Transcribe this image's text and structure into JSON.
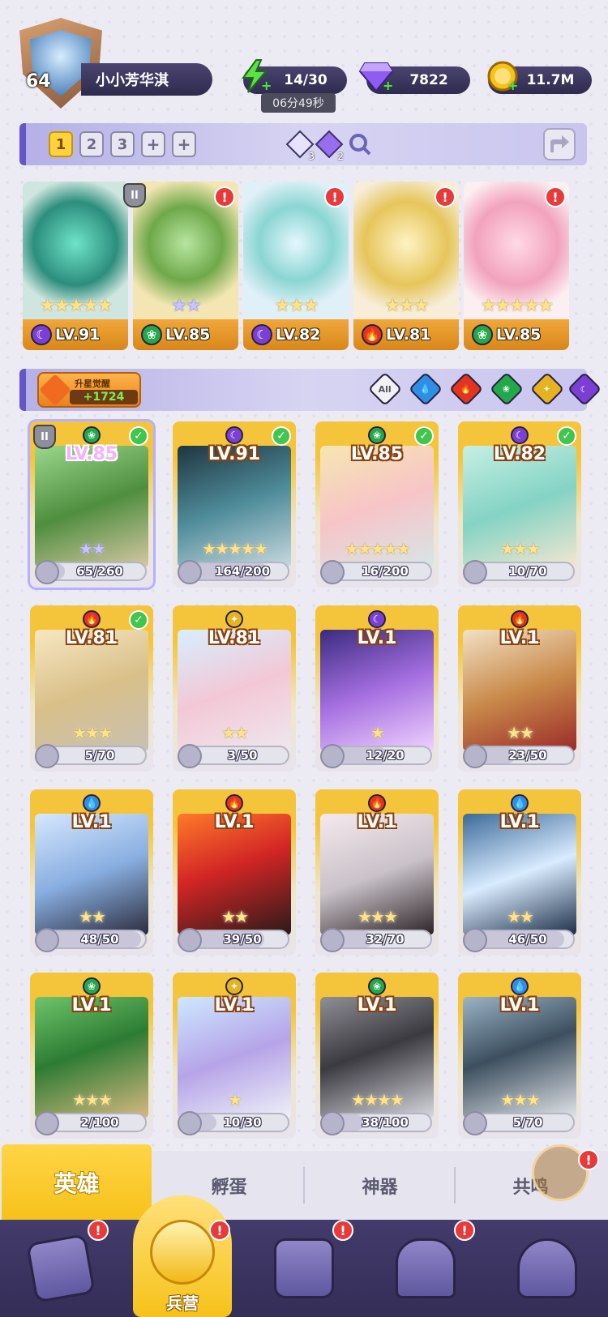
{
  "player": {
    "level": "64",
    "name": "小小芳华淇"
  },
  "resources": {
    "energy": "14/30",
    "energy_timer": "06分49秒",
    "gems": "7822",
    "gold": "11.7M"
  },
  "team_bar": {
    "tabs": [
      "1",
      "2",
      "3",
      "+",
      "+"
    ],
    "active_tab": "1",
    "token_counts": [
      "3",
      "2"
    ]
  },
  "team": [
    {
      "level": "LV.91",
      "element": "dark",
      "alert": false,
      "stars": "★★★★★",
      "star_color": "gold"
    },
    {
      "level": "LV.85",
      "element": "nature",
      "alert": true,
      "stars": "★★",
      "star_color": "purple",
      "rank": "II"
    },
    {
      "level": "LV.82",
      "element": "dark",
      "alert": true,
      "stars": "★★★",
      "star_color": "gold"
    },
    {
      "level": "LV.81",
      "element": "fire",
      "alert": true,
      "stars": "★★★",
      "star_color": "gold"
    },
    {
      "level": "LV.85",
      "element": "nature",
      "alert": true,
      "stars": "★★★★★",
      "star_color": "gold"
    }
  ],
  "filter_bar": {
    "awaken_title": "升星觉醒",
    "awaken_value": "+1724",
    "filters": [
      "All",
      "water",
      "fire",
      "nature",
      "light",
      "dark"
    ]
  },
  "heroes": [
    {
      "level": "LV.85",
      "element": "nature",
      "shards": "65/260",
      "progress": 0.25,
      "checked": true,
      "stars": "★★",
      "purple": true,
      "rank": "II"
    },
    {
      "level": "LV.91",
      "element": "dark",
      "shards": "164/200",
      "progress": 0.82,
      "checked": true,
      "stars": "★★★★★"
    },
    {
      "level": "LV.85",
      "element": "nature",
      "shards": "16/200",
      "progress": 0.08,
      "checked": true,
      "stars": "★★★★★"
    },
    {
      "level": "LV.82",
      "element": "dark",
      "shards": "10/70",
      "progress": 0.14,
      "checked": true,
      "stars": "★★★"
    },
    {
      "level": "LV.81",
      "element": "fire",
      "shards": "5/70",
      "progress": 0.07,
      "checked": true,
      "stars": "★★★"
    },
    {
      "level": "LV.81",
      "element": "light",
      "shards": "3/50",
      "progress": 0.06,
      "checked": false,
      "stars": "★★"
    },
    {
      "level": "LV.1",
      "element": "dark",
      "shards": "12/20",
      "progress": 0.6,
      "checked": false,
      "stars": "★"
    },
    {
      "level": "LV.1",
      "element": "fire",
      "shards": "23/50",
      "progress": 0.46,
      "checked": false,
      "stars": "★★"
    },
    {
      "level": "LV.1",
      "element": "water",
      "shards": "48/50",
      "progress": 0.96,
      "checked": false,
      "stars": "★★"
    },
    {
      "level": "LV.1",
      "element": "fire",
      "shards": "39/50",
      "progress": 0.78,
      "checked": false,
      "stars": "★★"
    },
    {
      "level": "LV.1",
      "element": "fire",
      "shards": "32/70",
      "progress": 0.46,
      "checked": false,
      "stars": "★★★"
    },
    {
      "level": "LV.1",
      "element": "water",
      "shards": "46/50",
      "progress": 0.92,
      "checked": false,
      "stars": "★★"
    },
    {
      "level": "LV.1",
      "element": "nature",
      "shards": "2/100",
      "progress": 0.02,
      "checked": false,
      "stars": "★★★"
    },
    {
      "level": "LV.1",
      "element": "light",
      "shards": "10/30",
      "progress": 0.33,
      "checked": false,
      "stars": "★"
    },
    {
      "level": "LV.1",
      "element": "nature",
      "shards": "38/100",
      "progress": 0.38,
      "checked": false,
      "stars": "★★★★"
    },
    {
      "level": "LV.1",
      "element": "water",
      "shards": "5/70",
      "progress": 0.07,
      "checked": false,
      "stars": "★★★"
    }
  ],
  "section_tabs": [
    "英雄",
    "孵蛋",
    "神器",
    "共鸣"
  ],
  "active_section": "英雄",
  "bottom_nav": {
    "active_label": "兵营",
    "items": [
      {
        "icon": "cards-icon",
        "alert": true
      },
      {
        "icon": "barracks-icon",
        "alert": true,
        "label": "兵营"
      },
      {
        "icon": "map-icon",
        "alert": true
      },
      {
        "icon": "castle-icon",
        "alert": true
      },
      {
        "icon": "mushroom-icon",
        "alert": false
      }
    ]
  },
  "colors": {
    "dark": "#7b3fd6",
    "nature": "#22a94a",
    "fire": "#e2341f",
    "water": "#2f8fe6",
    "light": "#e6b320",
    "accent_yellow": "#f6c21a",
    "nav_bg": "#3b3461"
  }
}
